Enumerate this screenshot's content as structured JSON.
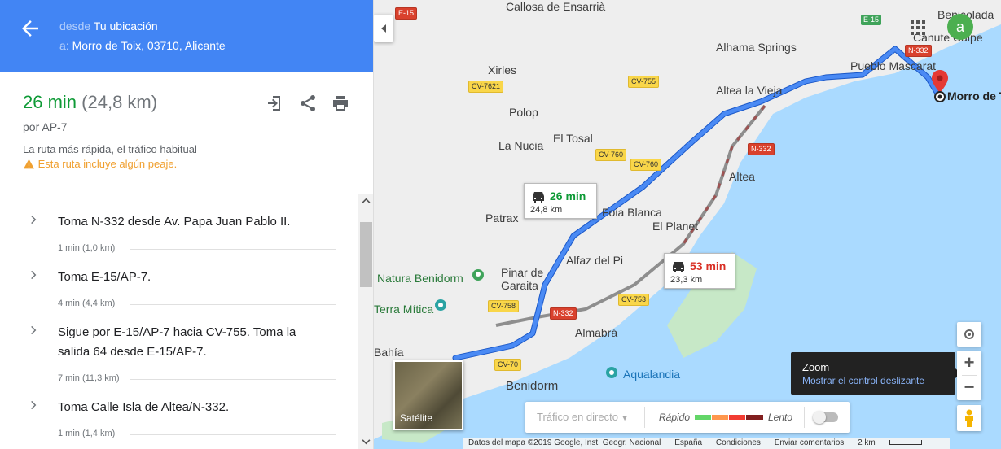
{
  "header": {
    "from_prefix": "desde",
    "from_value": "Tu ubicación",
    "to_prefix": "a:",
    "to_value": "Morro de Toix, 03710, Alicante"
  },
  "summary": {
    "duration": "26 min",
    "distance": "(24,8 km)",
    "via": "por AP-7",
    "description": "La ruta más rápida, el tráfico habitual",
    "toll_warning": "Esta ruta incluye algún peaje."
  },
  "steps": [
    {
      "text": "Toma N-332 desde Av. Papa Juan Pablo II.",
      "meta": "1 min (1,0 km)"
    },
    {
      "text": "Toma E-15/AP-7.",
      "meta": "4 min (4,4 km)"
    },
    {
      "text": "Sigue por E-15/AP-7 hacia CV-755. Toma la salida 64 desde E-15/AP-7.",
      "meta": "7 min (11,3 km)"
    },
    {
      "text": "Toma Calle Isla de Altea/N-332.",
      "meta": "1 min (1,4 km)"
    }
  ],
  "map": {
    "places": [
      "Callosa de Ensarrià",
      "Xirles",
      "Polop",
      "El Tosal",
      "La Nucia",
      "Alhama Springs",
      "Altea la Vieja",
      "Pueblo Mascarat",
      "Benicolada",
      "Canute Calpe",
      "Altea",
      "Patrax",
      "Foia Blanca",
      "El Planet",
      "Alfaz del Pi",
      "Pinar de Garaita",
      "Natura Benidorm",
      "Terra Mítica",
      "Almabrá",
      "Bahía",
      "Benidorm",
      "Aqualandia",
      "Morro de Toix"
    ],
    "roads": [
      "E-15",
      "N-332",
      "CV-7621",
      "CV-755",
      "CV-760",
      "CV-760",
      "N-332",
      "N-332",
      "CV-758",
      "CV-753",
      "CV-70",
      "CV-70"
    ],
    "route_primary": {
      "duration": "26 min",
      "distance": "24,8 km"
    },
    "route_alt": {
      "duration": "53 min",
      "distance": "23,3 km"
    },
    "satellite_label": "Satélite",
    "traffic_label": "Tráfico en directo",
    "traffic_fast": "Rápido",
    "traffic_slow": "Lento",
    "zoom_title": "Zoom",
    "zoom_link": "Mostrar el control deslizante",
    "avatar_letter": "a",
    "footer": {
      "data": "Datos del mapa ©2019 Google, Inst. Geogr. Nacional",
      "country": "España",
      "terms": "Condiciones",
      "feedback": "Enviar comentarios",
      "scale": "2 km"
    },
    "colors": {
      "route": "#4a8af4",
      "alt_route": "#8e8e8e",
      "sea": "#aadaff",
      "land": "#eeeeee"
    }
  }
}
